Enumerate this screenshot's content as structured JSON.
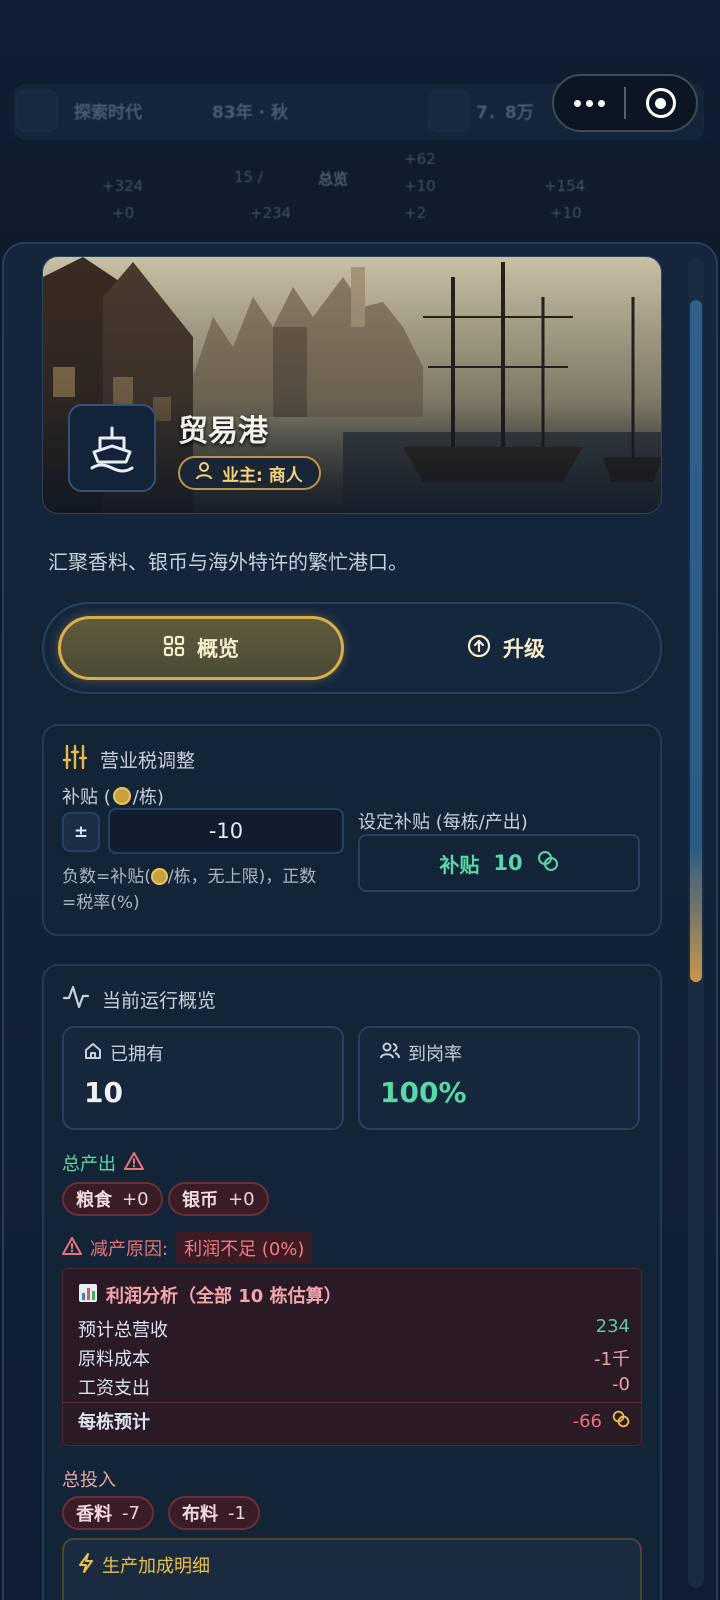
{
  "background": {
    "era": "探索时代",
    "date": "83年 · 秋",
    "money": "7．8万",
    "overview_btn": "总览",
    "stats": [
      "+324",
      "+0",
      "15 /",
      "+234",
      "+62",
      "+10",
      "+2",
      "+154",
      "+10"
    ]
  },
  "building": {
    "name": "贸易港",
    "owner": "业主: 商人",
    "description": "汇聚香料、银币与海外特许的繁忙港口。"
  },
  "tabs": [
    {
      "label": "概览",
      "active": true
    },
    {
      "label": "升级",
      "active": false
    }
  ],
  "tax": {
    "title": "营业税调整",
    "subsidy_label_prefix": "补贴 (",
    "subsidy_label_suffix": "/栋)",
    "toggle": "±",
    "input_value": "-10",
    "hint_prefix": "负数=补贴(",
    "hint_mid": "/栋，无上限)，正数",
    "hint_suffix": "=税率(%)",
    "set_label": "设定补贴 (每栋/产出)",
    "set_button_text": "补贴",
    "set_button_value": "10"
  },
  "overview": {
    "title": "当前运行概览",
    "owned_label": "已拥有",
    "owned_value": "10",
    "staffing_label": "到岗率",
    "staffing_value": "100%",
    "output_title": "总产出",
    "outputs": [
      {
        "name": "粮食",
        "value": "+0"
      },
      {
        "name": "银币",
        "value": "+0"
      }
    ],
    "reduction_label": "减产原因:",
    "reduction_reason": "利润不足 (0%)",
    "profit": {
      "title": "利润分析（全部 10 栋估算）",
      "rows": [
        {
          "label": "预计总营收",
          "value": "234",
          "color": "#59c9a5"
        },
        {
          "label": "原料成本",
          "value": "-1千",
          "color": "#e8a3a8"
        },
        {
          "label": "工资支出",
          "value": "-0",
          "color": "#e8a3a8"
        }
      ],
      "per_building_label": "每栋预计",
      "per_building_value": "-66"
    },
    "input_title": "总投入",
    "inputs": [
      {
        "name": "香料",
        "value": "-7"
      },
      {
        "name": "布料",
        "value": "-1"
      }
    ],
    "bonus_title": "生产加成明细"
  },
  "colors": {
    "gold": "#d8b04a",
    "green": "#59c9a5",
    "red": "#e8737a",
    "teal": "#5bd6a8"
  }
}
